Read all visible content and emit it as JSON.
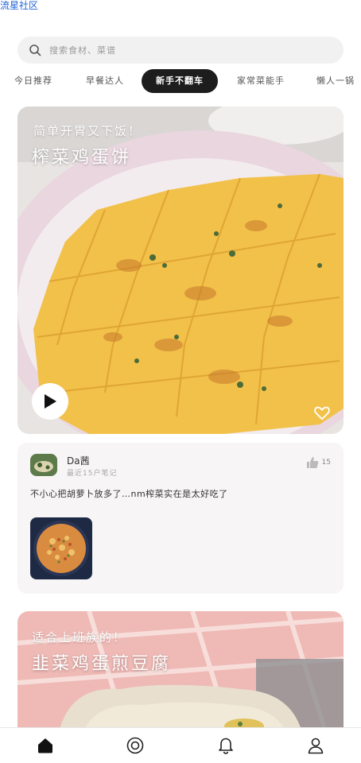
{
  "header": {
    "app_link": "流星社区"
  },
  "search": {
    "placeholder": "搜索食材、菜谱"
  },
  "tabs": [
    {
      "label": "今日推荐"
    },
    {
      "label": "早餐达人"
    },
    {
      "label": "新手不翻车",
      "active": true
    },
    {
      "label": "家常菜能手"
    },
    {
      "label": "懒人一锅"
    }
  ],
  "hero": {
    "subtitle": "简单开胃又下饭！",
    "title": "榨菜鸡蛋饼",
    "play_icon": "play-icon",
    "favorite_icon": "heart-icon"
  },
  "post": {
    "author": "Da茜",
    "meta": "最近15户笔记",
    "likes": "15",
    "text": "不小心把胡萝卜放多了…nm榨菜实在是太好吃了"
  },
  "second_card": {
    "subtitle": "适合上班族的！",
    "title": "韭菜鸡蛋煎豆腐"
  },
  "bottom_nav": [
    {
      "name": "home",
      "icon": "home-icon",
      "active": true
    },
    {
      "name": "discover",
      "icon": "target-icon"
    },
    {
      "name": "notifications",
      "icon": "bell-icon"
    },
    {
      "name": "profile",
      "icon": "user-icon"
    }
  ],
  "colors": {
    "active_tab_bg": "#1d1d1d",
    "link": "#1e63d8",
    "card_bg": "#f7f5f5",
    "omelet": "#f2c14a"
  }
}
